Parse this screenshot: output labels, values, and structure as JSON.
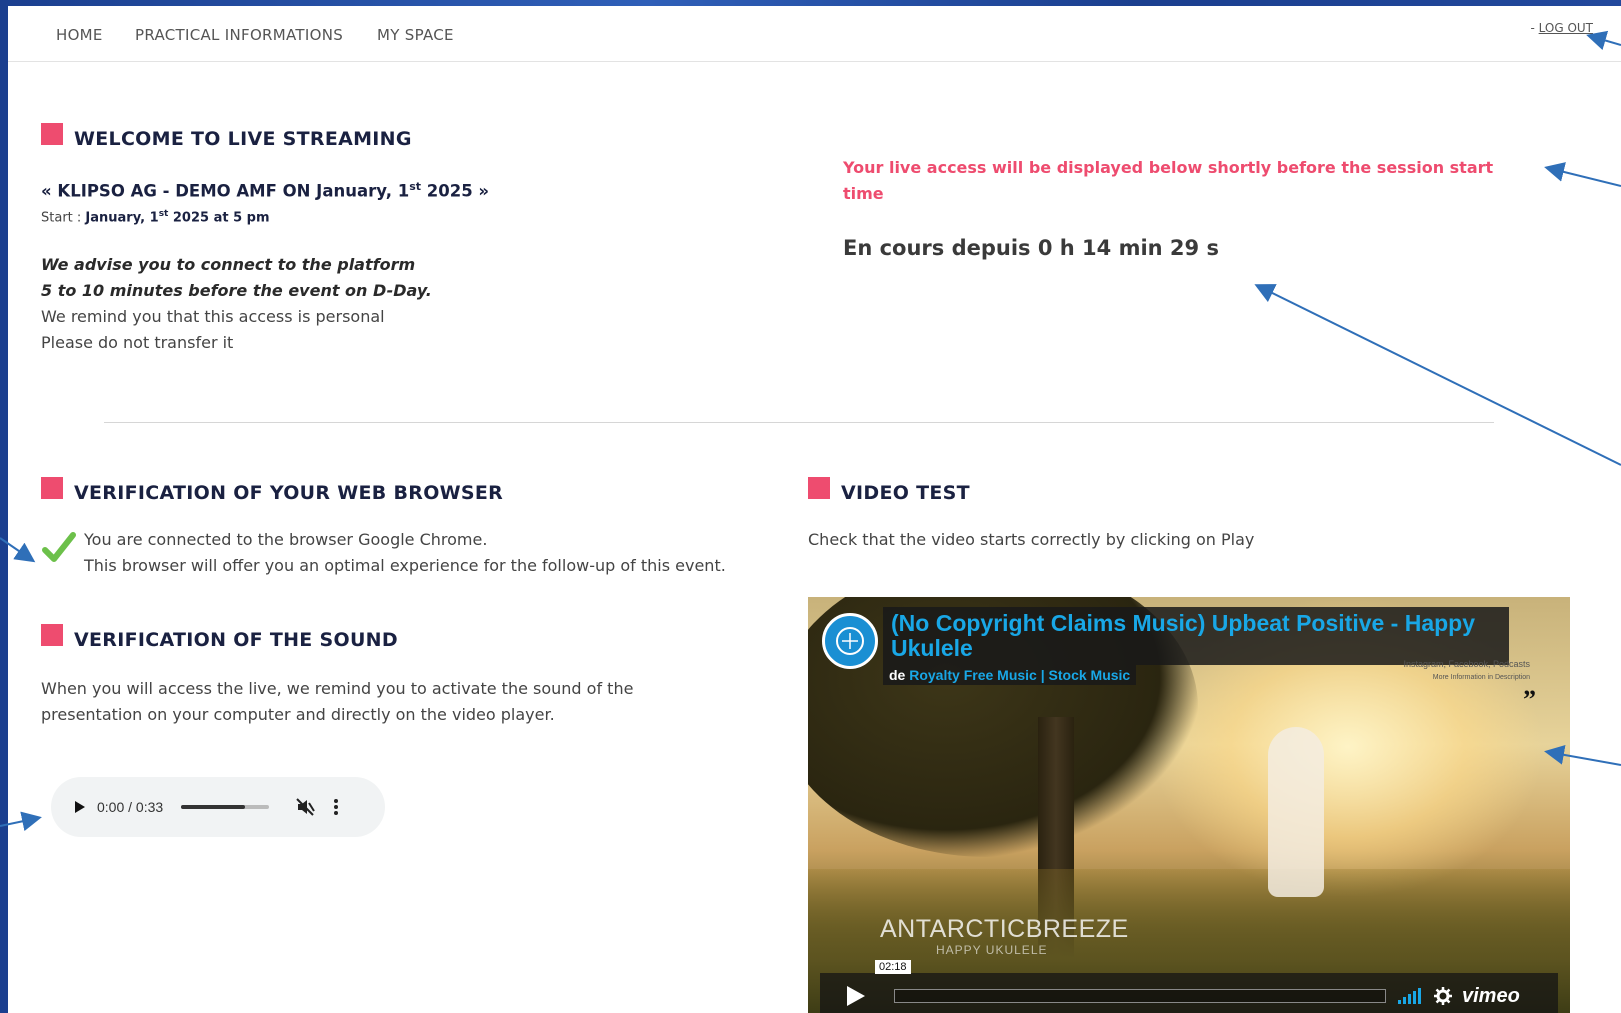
{
  "nav": {
    "items": [
      "HOME",
      "PRACTICAL INFORMATIONS",
      "MY SPACE"
    ],
    "logout_prefix": "- ",
    "logout": "LOG OUT"
  },
  "welcome": {
    "title": "WELCOME TO LIVE STREAMING",
    "event_prefix": "« KLIPSO AG - DEMO AMF ON January, 1",
    "event_sup": "st",
    "event_suffix": " 2025 »",
    "start_label": "Start : ",
    "start_date": "January, 1",
    "start_sup": "st",
    "start_time": " 2025 at 5 pm",
    "advice_line1": "We advise you to connect to the platform",
    "advice_line2": "5 to 10 minutes before the event on D-Day.",
    "remind_line1": "We remind you that this access is personal",
    "remind_line2": "Please do not transfer it"
  },
  "live": {
    "notice_line1": "Your live access will be displayed below shortly before the session start",
    "notice_line2": "time",
    "status": "En cours depuis 0 h 14 min 29 s"
  },
  "browser": {
    "title": "VERIFICATION OF YOUR WEB BROWSER",
    "line1": "You are connected to the browser Google Chrome.",
    "line2": "This browser will offer you an optimal experience for the follow-up of this event."
  },
  "sound": {
    "title": "VERIFICATION OF THE SOUND",
    "line1": "When you will access the live, we remind you to activate the sound of the",
    "line2": "presentation on your computer and directly on the video player.",
    "audio_time": "0:00 / 0:33",
    "volume_fraction": 0.72
  },
  "video": {
    "title": "VIDEO TEST",
    "instruction": "Check that the video starts correctly by clicking on Play",
    "video_title": "(No Copyright Claims Music) Upbeat Positive - Happy Ukulele",
    "by_prefix": "de ",
    "channel": "Royalty Free Music | Stock Music",
    "overlay_brand": "ANTARCTICBREEZE",
    "overlay_sub": "HAPPY UKULELE",
    "corner_text1": "Instagram, Facebook, Podcasts",
    "corner_text2": "More Information in Description",
    "timestamp": "02:18",
    "player_brand": "vimeo"
  },
  "colors": {
    "accent": "#ee4c6f",
    "navy": "#1a2141",
    "link_blue": "#19a7e6",
    "frame_blue": "#1b3f8f",
    "check_green": "#6cc04a"
  }
}
